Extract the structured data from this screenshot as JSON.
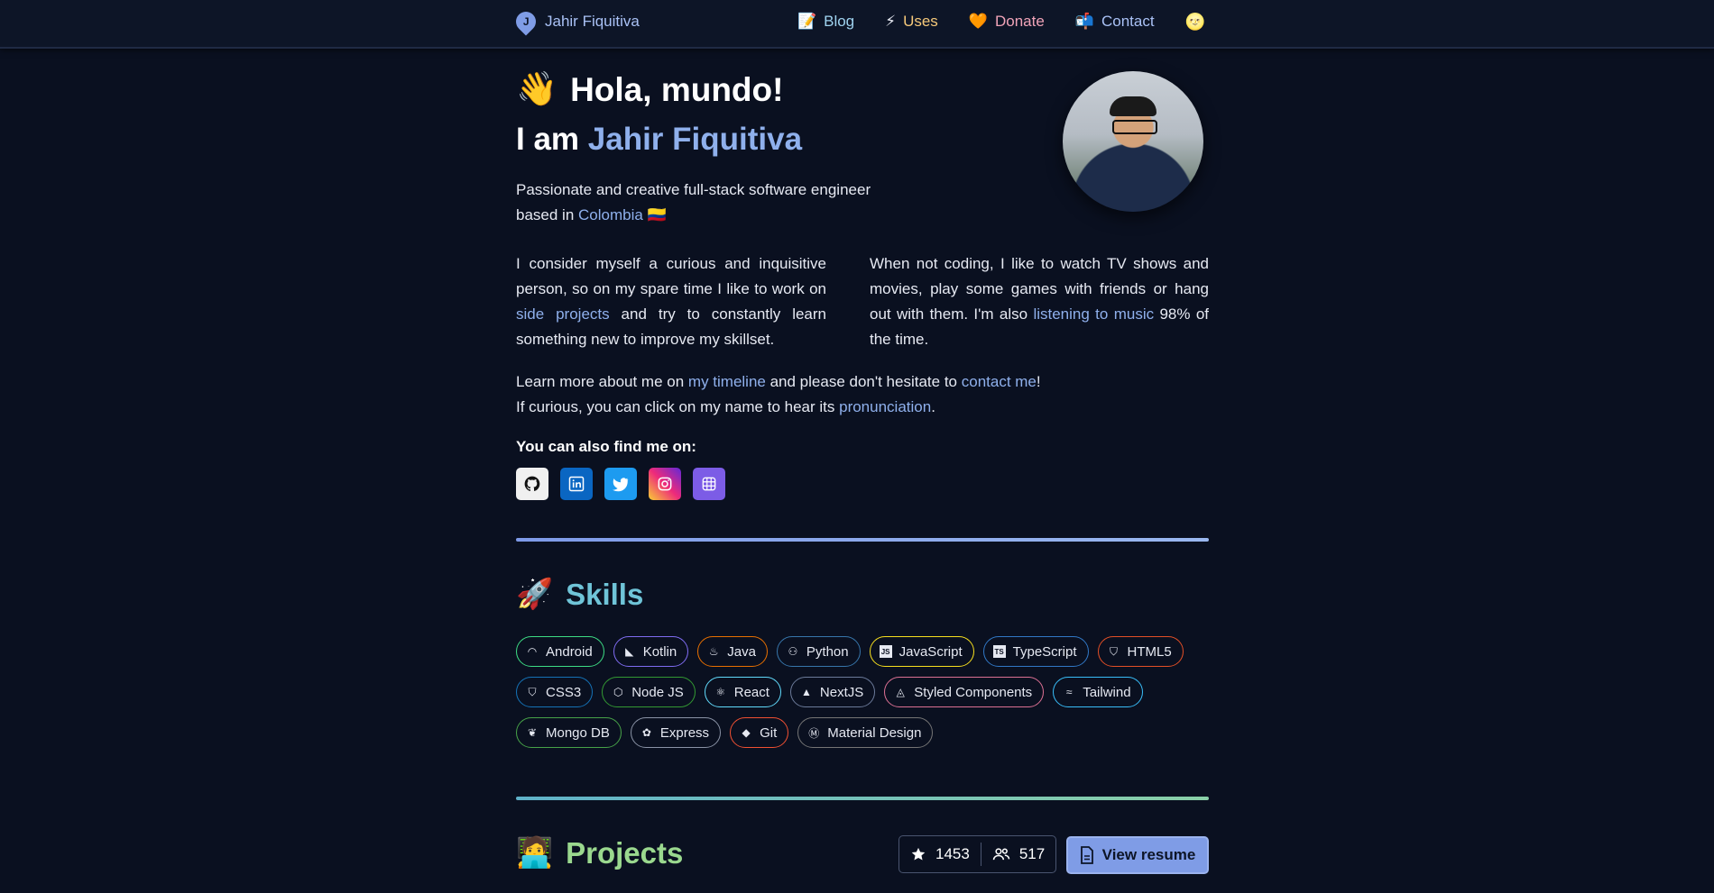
{
  "nav": {
    "brand": "Jahir Fiquitiva",
    "brand_icon": "location-pin-logo-icon",
    "items": [
      {
        "emoji": "📝",
        "label": "Blog",
        "color": "#9fd3f0"
      },
      {
        "emoji": "⚡",
        "label": "Uses",
        "color": "#f6c97a"
      },
      {
        "emoji": "🧡",
        "label": "Donate",
        "color": "#f0a3b8"
      },
      {
        "emoji": "📬",
        "label": "Contact",
        "color": "#a9c1f5"
      }
    ],
    "theme_toggle": "🌝"
  },
  "hero": {
    "wave": "👋",
    "greeting": "Hola, mundo!",
    "iam": "I am ",
    "name": "Jahir Fiquitiva",
    "tagline_1": "Passionate and creative full-stack software engineer based in ",
    "tagline_link": "Colombia",
    "tagline_flag": "🇨🇴"
  },
  "about": {
    "left_1": "I consider myself a curious and inquisitive person, so on my spare time I like to work on ",
    "left_link": "side projects",
    "left_2": " and try to constantly learn something new to improve my skillset.",
    "right_1": "When not coding, I like to watch TV shows and movies, play some games with friends or hang out with them. I'm also ",
    "right_link": "listening to music",
    "right_2": " 98% of the time.",
    "learn_1": "Learn more about me on ",
    "learn_link_1": "my timeline",
    "learn_2": " and please don't hesitate to ",
    "learn_link_2": "contact me",
    "learn_3": "!",
    "curious_1": "If curious, you can click on my name to hear its ",
    "curious_link": "pronunciation",
    "curious_2": "."
  },
  "find": {
    "label": "You can also find me on:",
    "socials": [
      {
        "name": "github-icon",
        "bg": "#f0f0f0"
      },
      {
        "name": "linkedin-icon",
        "bg": "#0a66c2"
      },
      {
        "name": "twitter-icon",
        "bg": "#1d9bf0"
      },
      {
        "name": "instagram-icon",
        "bg": "#d62976"
      },
      {
        "name": "polywork-icon",
        "bg": "#7c5ce6"
      }
    ]
  },
  "skills": {
    "emoji": "🚀",
    "title": "Skills",
    "items": [
      {
        "label": "Android",
        "icon": "android-icon",
        "color": "#3ddc84"
      },
      {
        "label": "Kotlin",
        "icon": "kotlin-icon",
        "color": "#7f6cf2"
      },
      {
        "label": "Java",
        "icon": "java-icon",
        "color": "#e76f00"
      },
      {
        "label": "Python",
        "icon": "python-icon",
        "color": "#3776ab"
      },
      {
        "label": "JavaScript",
        "icon": "javascript-icon",
        "color": "#f7df1e"
      },
      {
        "label": "TypeScript",
        "icon": "typescript-icon",
        "color": "#3178c6"
      },
      {
        "label": "HTML5",
        "icon": "html5-icon",
        "color": "#e34f26"
      },
      {
        "label": "CSS3",
        "icon": "css3-icon",
        "color": "#1572b6"
      },
      {
        "label": "Node JS",
        "icon": "nodejs-icon",
        "color": "#339933"
      },
      {
        "label": "React",
        "icon": "react-icon",
        "color": "#61dafb"
      },
      {
        "label": "NextJS",
        "icon": "nextjs-icon",
        "color": "#6b7a99"
      },
      {
        "label": "Styled Components",
        "icon": "styled-components-icon",
        "color": "#db7093"
      },
      {
        "label": "Tailwind",
        "icon": "tailwind-icon",
        "color": "#38bdf8"
      },
      {
        "label": "Mongo DB",
        "icon": "mongodb-icon",
        "color": "#47a248"
      },
      {
        "label": "Express",
        "icon": "express-icon",
        "color": "#8a93a6"
      },
      {
        "label": "Git",
        "icon": "git-icon",
        "color": "#f05032"
      },
      {
        "label": "Material Design",
        "icon": "material-design-icon",
        "color": "#757575"
      }
    ]
  },
  "projects": {
    "emoji": "🧑‍💻",
    "title": "Projects",
    "stars": "1453",
    "followers": "517",
    "resume_label": "View resume"
  }
}
